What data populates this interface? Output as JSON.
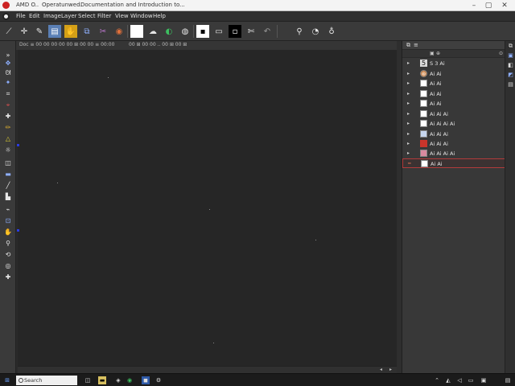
{
  "window": {
    "app_short": "AMD O..",
    "title_a": "Operatunwed.",
    "title_b": "Documentation and Introduction to...",
    "minimize_icon": "minimize-icon",
    "maximize_icon": "maximize-icon",
    "close_icon": "close-icon"
  },
  "menu": {
    "items": [
      "File",
      "Edit",
      "Image",
      "Layer",
      "Select",
      "Filter",
      "View",
      "Window",
      "Help"
    ]
  },
  "options_bar": {
    "text_a": "Doc ≡ 00 00 00 00 00 ⊞ 00 00 ≡ 00:00",
    "text_b": "00 ⊞ 00 00 .. 00 ⊞ 00 ⊞"
  },
  "layers_panel": {
    "header_icon": "layers-icon",
    "items": [
      {
        "name": "S 3 Ai",
        "thumb": "#d9d9d9",
        "glyph": "5"
      },
      {
        "name": "Ai Ai",
        "thumb": "#c87a3a",
        "glyph": "⊛"
      },
      {
        "name": "Ai Ai",
        "thumb": "#ffffff",
        "glyph": ""
      },
      {
        "name": "Ai Ai",
        "thumb": "#ffffff",
        "glyph": ""
      },
      {
        "name": "Ai Ai",
        "thumb": "#ffffff",
        "glyph": ""
      },
      {
        "name": "Ai Ai Ai",
        "thumb": "#ffffff",
        "glyph": ""
      },
      {
        "name": "Ai Ai Ai Ai",
        "thumb": "#ffffff",
        "glyph": ""
      },
      {
        "name": "Ai Ai Ai",
        "thumb": "#c7d6ee",
        "glyph": ""
      },
      {
        "name": "Ai Ai Ai",
        "thumb": "#c8352b",
        "glyph": ""
      },
      {
        "name": "Ai Ai Ai Ai",
        "thumb": "#d88aa0",
        "glyph": ""
      },
      {
        "name": "Ai Ai",
        "thumb": "#ffffff",
        "glyph": ""
      }
    ],
    "selected_index": 10
  },
  "taskbar": {
    "search_placeholder": "Search",
    "start_icon": "windows-start-icon"
  },
  "colors": {
    "accent_red": "#b23b3b",
    "marker_blue": "#2b3ce0"
  }
}
